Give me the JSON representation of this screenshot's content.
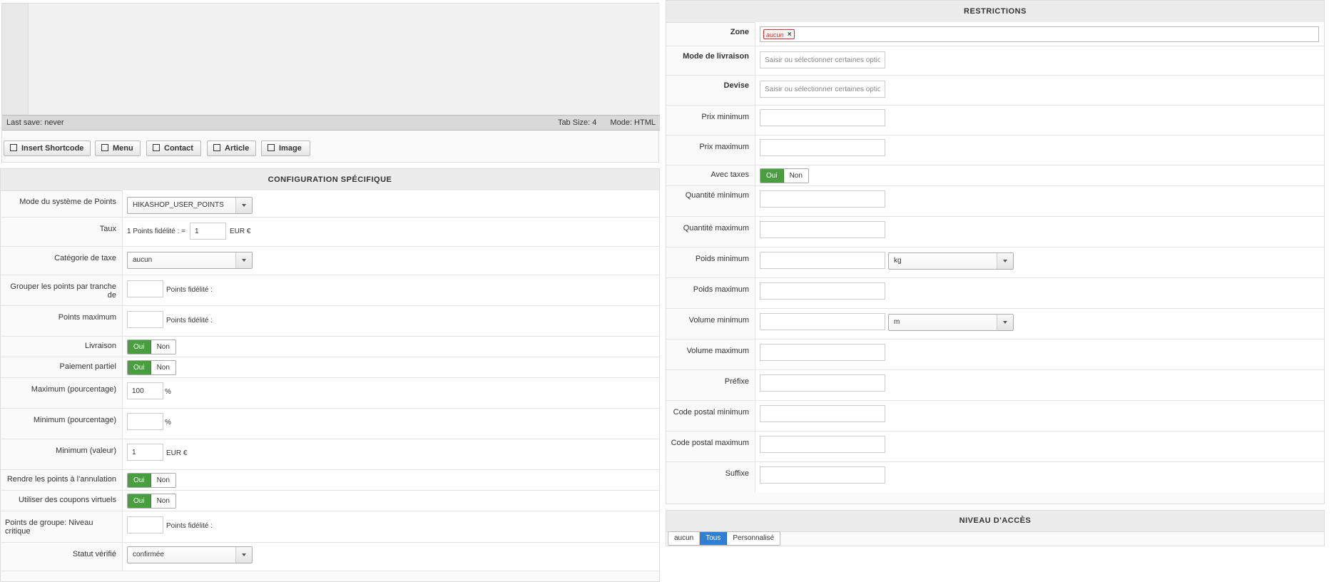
{
  "editor": {
    "last_save": "Last save: never",
    "tab_size": "Tab Size: 4",
    "mode": "Mode: HTML",
    "buttons": [
      {
        "label": "Insert Shortcode",
        "icon": "edit-icon"
      },
      {
        "label": "Menu",
        "icon": "share-icon"
      },
      {
        "label": "Contact",
        "icon": "address-book-icon"
      },
      {
        "label": "Article",
        "icon": "file-add-icon"
      },
      {
        "label": "Image",
        "icon": "image-icon"
      }
    ]
  },
  "config": {
    "title": "CONFIGURATION SPÉCIFIQUE",
    "points_mode": {
      "label": "Mode du système de Points",
      "value": "HIKASHOP_USER_POINTS"
    },
    "rate": {
      "label": "Taux",
      "prefix": "1 Points fidélité : =",
      "value": "1",
      "suffix": "EUR €"
    },
    "tax_category": {
      "label": "Catégorie de taxe",
      "value": "aucun"
    },
    "group_points": {
      "label": "Grouper les points par tranche de",
      "value": "",
      "suffix": "Points fidélité :"
    },
    "max_points": {
      "label": "Points maximum",
      "value": "",
      "suffix": "Points fidélité :"
    },
    "shipping": {
      "label": "Livraison",
      "yes": "Oui",
      "no": "Non"
    },
    "partial_payment": {
      "label": "Paiement partiel",
      "yes": "Oui",
      "no": "Non"
    },
    "max_percent": {
      "label": "Maximum (pourcentage)",
      "value": "100",
      "suffix": "%"
    },
    "min_percent": {
      "label": "Minimum (pourcentage)",
      "value": "",
      "suffix": "%"
    },
    "min_value": {
      "label": "Minimum (valeur)",
      "value": "1",
      "suffix": "EUR €"
    },
    "return_points": {
      "label": "Rendre les points à l'annulation",
      "yes": "Oui",
      "no": "Non"
    },
    "virtual_coupons": {
      "label": "Utiliser des coupons virtuels",
      "yes": "Oui",
      "no": "Non"
    },
    "group_critical": {
      "label": "Points de groupe: Niveau critique",
      "value": "",
      "suffix": "Points fidélité :"
    },
    "verified_status": {
      "label": "Statut vérifié",
      "value": "confirmée"
    }
  },
  "restrictions": {
    "title": "RESTRICTIONS",
    "zone": {
      "label": "Zone",
      "tag": "aucun"
    },
    "shipping_mode": {
      "label": "Mode de livraison",
      "placeholder": "Saisir ou sélectionner certaines options"
    },
    "currency": {
      "label": "Devise",
      "placeholder": "Saisir ou sélectionner certaines options"
    },
    "min_price": {
      "label": "Prix minimum"
    },
    "max_price": {
      "label": "Prix maximum"
    },
    "with_taxes": {
      "label": "Avec taxes",
      "yes": "Oui",
      "no": "Non"
    },
    "min_qty": {
      "label": "Quantité minimum"
    },
    "max_qty": {
      "label": "Quantité maximum"
    },
    "min_weight": {
      "label": "Poids minimum",
      "unit": "kg"
    },
    "max_weight": {
      "label": "Poids maximum"
    },
    "min_volume": {
      "label": "Volume minimum",
      "unit": "m"
    },
    "max_volume": {
      "label": "Volume maximum"
    },
    "prefix": {
      "label": "Préfixe"
    },
    "min_postcode": {
      "label": "Code postal minimum"
    },
    "max_postcode": {
      "label": "Code postal maximum"
    },
    "suffix": {
      "label": "Suffixe"
    }
  },
  "access": {
    "title": "NIVEAU D'ACCÈS",
    "options": [
      "aucun",
      "Tous",
      "Personnalisé"
    ],
    "selected": "Tous"
  },
  "colors": {
    "toggle_on": "#4a9e3f",
    "access_on": "#2f7fd4",
    "tag": "#cc3333"
  }
}
